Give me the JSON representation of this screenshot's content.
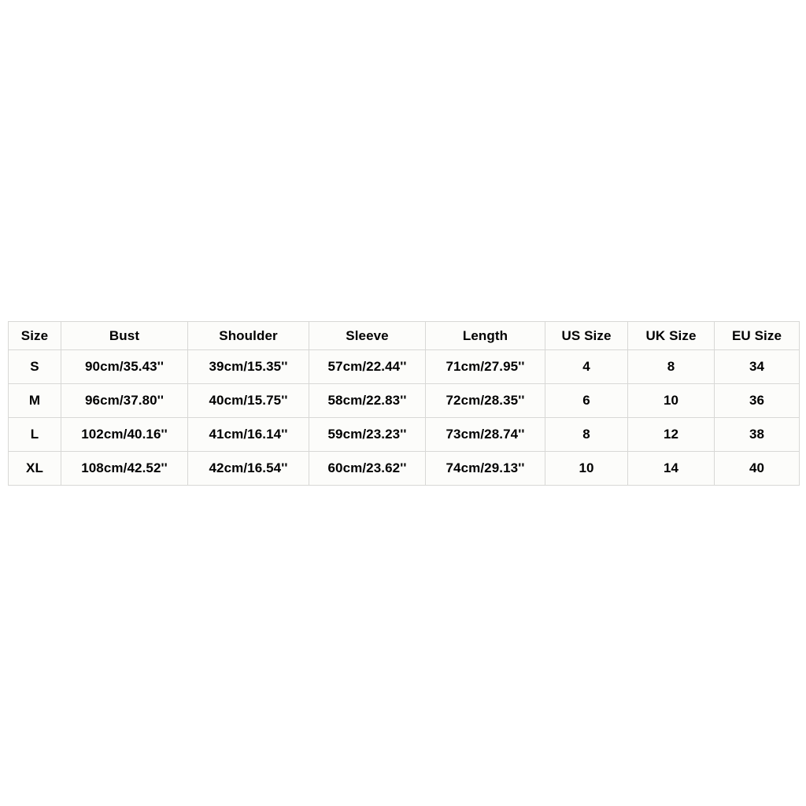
{
  "table": {
    "name": "size-chart",
    "columns": [
      "Size",
      "Bust",
      "Shoulder",
      "Sleeve",
      "Length",
      "US Size",
      "UK Size",
      "EU Size"
    ],
    "rows": [
      {
        "size": "S",
        "bust": "90cm/35.43''",
        "shoulder": "39cm/15.35''",
        "sleeve": "57cm/22.44''",
        "length": "71cm/27.95''",
        "us_size": "4",
        "uk_size": "8",
        "eu_size": "34"
      },
      {
        "size": "M",
        "bust": "96cm/37.80''",
        "shoulder": "40cm/15.75''",
        "sleeve": "58cm/22.83''",
        "length": "72cm/28.35''",
        "us_size": "6",
        "uk_size": "10",
        "eu_size": "36"
      },
      {
        "size": "L",
        "bust": "102cm/40.16''",
        "shoulder": "41cm/16.14''",
        "sleeve": "59cm/23.23''",
        "length": "73cm/28.74''",
        "us_size": "8",
        "uk_size": "12",
        "eu_size": "38"
      },
      {
        "size": "XL",
        "bust": "108cm/42.52''",
        "shoulder": "42cm/16.54''",
        "sleeve": "60cm/23.62''",
        "length": "74cm/29.13''",
        "us_size": "10",
        "uk_size": "14",
        "eu_size": "40"
      }
    ]
  },
  "colors": {
    "page_background": "#ffffff",
    "cell_background": "#fcfcfa",
    "border": "#d8d8d6",
    "text": "#000000"
  }
}
